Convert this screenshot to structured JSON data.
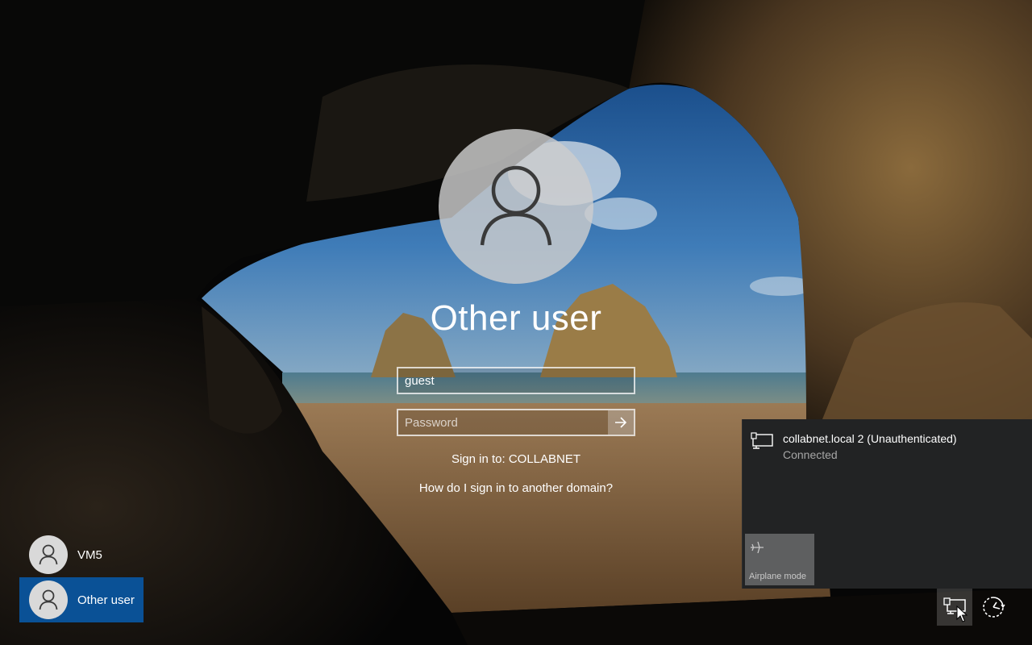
{
  "signin": {
    "user_display_name": "Other user",
    "username_value": "guest",
    "password_placeholder": "Password",
    "sign_in_to": "Sign in to: COLLABNET",
    "help_link": "How do I sign in to another domain?"
  },
  "user_list": [
    {
      "name": "VM5",
      "selected": false
    },
    {
      "name": "Other user",
      "selected": true
    }
  ],
  "network_flyout": {
    "network_name": "collabnet.local 2 (Unauthenticated)",
    "network_status": "Connected",
    "airplane_mode_label": "Airplane mode"
  },
  "icons": {
    "avatar": "person-icon",
    "submit": "arrow-right-icon",
    "network": "ethernet-network-icon",
    "airplane": "airplane-icon",
    "ease_of_access": "ease-of-access-icon"
  },
  "colors": {
    "selected_tile": "#0a5196",
    "flyout_bg": "#222324",
    "airplane_tile_bg": "#5e5f60"
  }
}
